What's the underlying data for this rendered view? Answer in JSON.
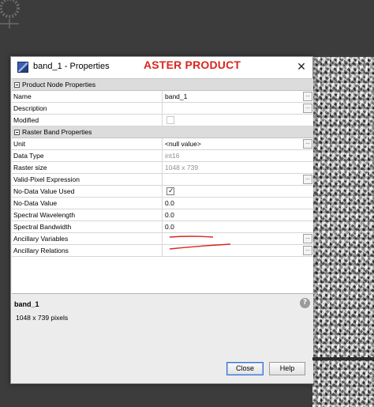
{
  "dialog": {
    "title": "band_1 - Properties",
    "annotation": "ASTER PRODUCT"
  },
  "sections": [
    {
      "label": "Product Node Properties",
      "rows": [
        {
          "name": "Name",
          "value": "band_1",
          "ellipsis": true
        },
        {
          "name": "Description",
          "value": "",
          "ellipsis": true
        },
        {
          "name": "Modified",
          "checkbox": "unchecked-disabled"
        }
      ]
    },
    {
      "label": "Raster Band Properties",
      "rows": [
        {
          "name": "Unit",
          "value": "<null value>",
          "ellipsis": true
        },
        {
          "name": "Data Type",
          "value": "int16",
          "disabled": true
        },
        {
          "name": "Raster size",
          "value": "1048 x 739",
          "disabled": true
        },
        {
          "name": "Valid-Pixel Expression",
          "value": "",
          "ellipsis": true
        },
        {
          "name": "No-Data Value Used",
          "checkbox": "checked"
        },
        {
          "name": "No-Data Value",
          "value": "0.0"
        },
        {
          "name": "Spectral Wavelength",
          "value": "0.0"
        },
        {
          "name": "Spectral Bandwidth",
          "value": "0.0"
        },
        {
          "name": "Ancillary Variables",
          "value": "",
          "ellipsis": true
        },
        {
          "name": "Ancillary Relations",
          "value": "",
          "ellipsis": true
        }
      ]
    }
  ],
  "info": {
    "title": "band_1",
    "description": "1048 x 739 pixels",
    "help_icon": "question-circle-icon"
  },
  "buttons": {
    "close": "Close",
    "help": "Help"
  },
  "glyphs": {
    "close_x": "✕",
    "ellipsis": "...",
    "check": "✓",
    "help": "?"
  },
  "colors": {
    "annotation_red": "#d8261e",
    "background_dark": "#3c3c3c",
    "section_header": "#dcdcdc"
  }
}
